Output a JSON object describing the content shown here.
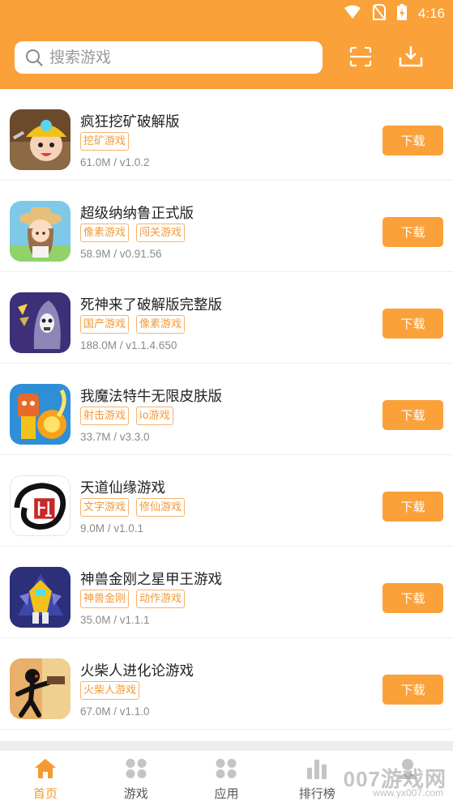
{
  "status_bar": {
    "time": "4:16"
  },
  "header": {
    "search_placeholder": "搜索游戏",
    "scan_icon": "scan-icon",
    "download_icon": "download-icon"
  },
  "games": [
    {
      "name": "疯狂挖矿破解版",
      "tags": [
        "挖矿游戏"
      ],
      "meta": "61.0M / v1.0.2",
      "button": "下载"
    },
    {
      "name": "超级纳纳鲁正式版",
      "tags": [
        "像素游戏",
        "闯关游戏"
      ],
      "meta": "58.9M / v0.91.56",
      "button": "下载"
    },
    {
      "name": "死神来了破解版完整版",
      "tags": [
        "国产游戏",
        "像素游戏"
      ],
      "meta": "188.0M / v1.1.4.650",
      "button": "下载"
    },
    {
      "name": "我魔法特牛无限皮肤版",
      "tags": [
        "射击游戏",
        "io游戏"
      ],
      "meta": "33.7M / v3.3.0",
      "button": "下载"
    },
    {
      "name": "天道仙缘游戏",
      "tags": [
        "文字游戏",
        "修仙游戏"
      ],
      "meta": "9.0M / v1.0.1",
      "button": "下载"
    },
    {
      "name": "神兽金刚之星甲王游戏",
      "tags": [
        "神兽金刚",
        "动作游戏"
      ],
      "meta": "35.0M / v1.1.1",
      "button": "下载"
    },
    {
      "name": "火柴人进化论游戏",
      "tags": [
        "火柴人游戏"
      ],
      "meta": "67.0M / v1.1.0",
      "button": "下载"
    }
  ],
  "bottom_nav": {
    "items": [
      {
        "label": "首页",
        "icon": "home-icon",
        "active": true
      },
      {
        "label": "游戏",
        "icon": "game-grid-icon",
        "active": false
      },
      {
        "label": "应用",
        "icon": "app-grid-icon",
        "active": false
      },
      {
        "label": "排行榜",
        "icon": "ranking-icon",
        "active": false
      },
      {
        "label": "",
        "icon": "user-icon",
        "active": false
      }
    ]
  },
  "watermark": {
    "text": "007游戏网",
    "sub": "www.yx007.com"
  },
  "colors": {
    "accent": "#fba13a",
    "tag_text": "#f29a36",
    "active_nav": "#f59a2f"
  }
}
